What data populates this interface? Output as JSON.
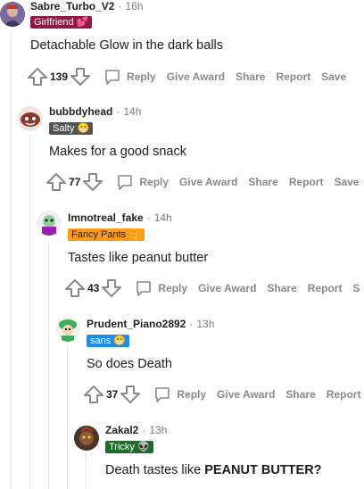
{
  "comments": [
    {
      "username": "Sabre_Turbo_V2",
      "time": "16h",
      "flair": "Girlfriend 💕",
      "flair_bg": "#8e1a45",
      "flair_fg": "#ffffff",
      "body": "Detachable Glow in the dark balls",
      "score": "139"
    },
    {
      "username": "bubbdyhead",
      "time": "14h",
      "flair": "Salty 😁",
      "flair_bg": "#545452",
      "flair_fg": "#ffffff",
      "body": "Makes for a good snack",
      "score": "77"
    },
    {
      "username": "Imnotreal_fake",
      "time": "14h",
      "flair": "Fancy Pants 👌",
      "flair_bg": "#ff9c1a",
      "flair_fg": "#1c1c1c",
      "body": "Tastes like peanut butter",
      "score": "43"
    },
    {
      "username": "Prudent_Piano2892",
      "time": "13h",
      "flair": "sans 😁",
      "flair_bg": "#1a8cf2",
      "flair_fg": "#ffffff",
      "body": "So does Death",
      "score": "37"
    },
    {
      "username": "Zakal2",
      "time": "13h",
      "flair": "Tricky 👽",
      "flair_bg": "#1e6b2a",
      "flair_fg": "#ffffff",
      "body_prefix": "Death tastes like ",
      "body_bold": "PEANUT BUTTER?"
    }
  ],
  "actions": {
    "reply": "Reply",
    "give_award": "Give Award",
    "share": "Share",
    "report": "Report",
    "save": "Save",
    "save_truncated": "S"
  },
  "colors": {
    "thread_line": "#e5e7ea",
    "action_text": "#878a8c",
    "vote_icon": "#878a8c"
  },
  "icons": [
    "upvote-icon",
    "downvote-icon",
    "reply-icon",
    "avatar"
  ]
}
